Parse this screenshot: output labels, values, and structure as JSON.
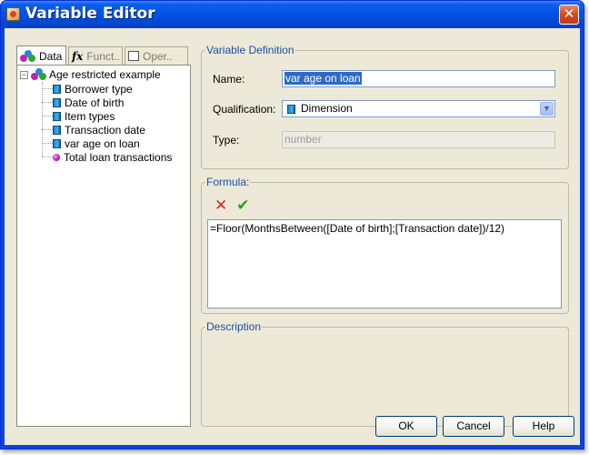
{
  "window": {
    "title": "Variable Editor",
    "close_label": "✕"
  },
  "tabs": [
    {
      "label": "Data",
      "icon": "universe-icon"
    },
    {
      "label": "Funct..",
      "icon": "fx-icon"
    },
    {
      "label": "Oper..",
      "icon": "operator-icon"
    }
  ],
  "tree": {
    "root": "Age restricted example",
    "items": [
      {
        "label": "Borrower type",
        "icon": "dimension-icon"
      },
      {
        "label": "Date of birth",
        "icon": "dimension-icon"
      },
      {
        "label": "Item types",
        "icon": "dimension-icon"
      },
      {
        "label": "Transaction date",
        "icon": "dimension-icon"
      },
      {
        "label": "var age on loan",
        "icon": "dimension-icon"
      },
      {
        "label": "Total loan transactions",
        "icon": "measure-icon"
      }
    ]
  },
  "variable_definition": {
    "title": "Variable Definition",
    "name_label": "Name:",
    "name_value": "var age on loan",
    "qualification_label": "Qualification:",
    "qualification_value": "Dimension",
    "type_label": "Type:",
    "type_value": "number"
  },
  "formula": {
    "title": "Formula:",
    "cancel_icon": "✕",
    "validate_icon": "✔",
    "text": "=Floor(MonthsBetween([Date of birth];[Transaction date])/12)"
  },
  "description": {
    "title": "Description",
    "text": ""
  },
  "buttons": {
    "ok": "OK",
    "cancel": "Cancel",
    "help": "Help"
  },
  "colors": {
    "titlebar": "#0055e5",
    "group_title": "#1d4fa4",
    "selection": "#316ac5",
    "close_button": "#d24a23"
  }
}
